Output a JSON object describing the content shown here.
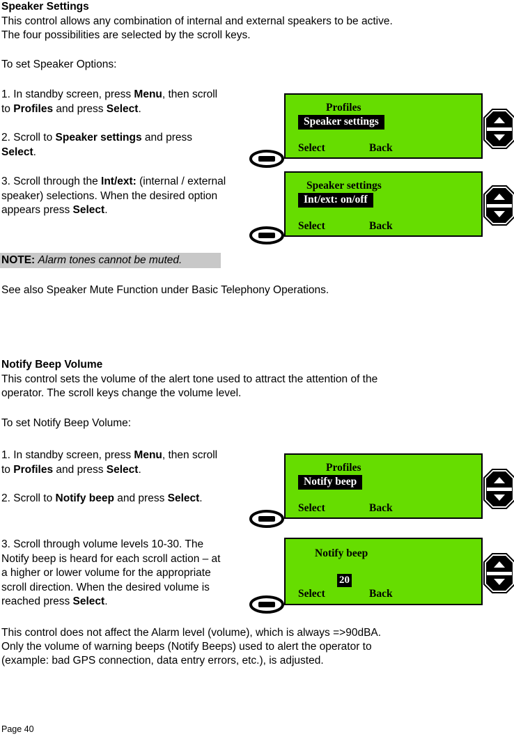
{
  "document": {
    "page_label": "Page 40"
  },
  "sections": [
    {
      "heading": "Speaker Settings",
      "intro_line1": "This control allows any combination of internal and external speakers to be active.",
      "intro_line2": "The four possibilities are selected by the scroll keys.",
      "lead_in": "To set Speaker Options:",
      "steps": [
        {
          "number": "1.",
          "text_html": "1. In standby screen, press <b>Menu</b>, then scroll\nto <b>Profiles</b> and press <b>Select</b>."
        },
        {
          "number": "2.",
          "text_html": "2. Scroll to <b>Speaker settings</b> and press\n<b>Select</b>."
        },
        {
          "number": "3.",
          "text_html": "3. Scroll through the <b>Int/ext:</b> (internal / external\nspeaker) selections. When the desired option\nappears press <b>Select</b>."
        }
      ],
      "note": {
        "label": "NOTE:",
        "text": "Alarm tones cannot be muted."
      },
      "see_also": "See also Speaker Mute Function under Basic Telephony Operations."
    },
    {
      "heading": "Notify Beep Volume",
      "intro_line1": "This control sets the volume of the alert tone used to attract the attention of the",
      "intro_line2": "operator. The scroll keys change the volume level.",
      "lead_in": "To set Notify Beep Volume:",
      "steps": [
        {
          "number": "1.",
          "text_html": "1. In standby screen, press <b>Menu</b>, then scroll\nto <b>Profiles</b> and press <b>Select</b>."
        },
        {
          "number": "2.",
          "text_html": "2. Scroll to <b>Notify beep</b> and press <b>Select</b>."
        },
        {
          "number": "3.",
          "text_html": "3. Scroll through volume levels 10-30. The\nNotify beep is heard for each scroll action – at\na higher or lower volume for the appropriate\nscroll direction. When the desired volume is\nreached press <b>Select</b>."
        }
      ],
      "closing_line1": "This control does not affect the Alarm level (volume), which is always =>90dBA.",
      "closing_line2": "Only the volume of warning beeps (Notify Beeps) used to alert the operator to",
      "closing_line3": "(example: bad GPS connection, data entry errors, etc.), is adjusted."
    }
  ],
  "screens": [
    {
      "id": "profiles-speaker-settings",
      "title": "Profiles",
      "highlight": "Speaker settings",
      "softkey_left": "Select",
      "softkey_right": "Back"
    },
    {
      "id": "speaker-settings-intext",
      "title": "Speaker settings",
      "highlight": "Int/ext: on/off",
      "softkey_left": "Select",
      "softkey_right": "Back"
    },
    {
      "id": "profiles-notify-beep",
      "title": "Profiles",
      "highlight": "Notify beep",
      "softkey_left": "Select",
      "softkey_right": "Back"
    },
    {
      "id": "notify-beep-value",
      "title": "Notify beep",
      "highlight": "20",
      "softkey_left": "Select",
      "softkey_right": "Back"
    }
  ],
  "colors": {
    "lcd_background": "#66dd00",
    "lcd_border": "#000000",
    "highlight_background": "#000000",
    "highlight_text": "#ffffff",
    "note_highlight": "#c8c8c8",
    "text": "#000000"
  },
  "icons": {
    "scroll_key": "scroll-key-up-down-icon",
    "soft_key": "soft-key-oval-icon"
  }
}
